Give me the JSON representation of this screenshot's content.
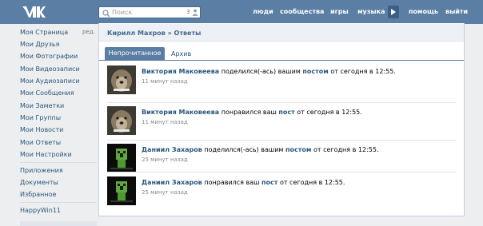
{
  "header": {
    "logo_text": "VK",
    "search": {
      "placeholder": "Поиск",
      "count": "3"
    },
    "nav": [
      "люди",
      "сообщества",
      "игры",
      "музыка",
      "помощь",
      "выйти"
    ]
  },
  "leftmenu": {
    "edit_label": "ред.",
    "items": [
      "Моя Страница",
      "Мои Друзья",
      "Мои Фотографии",
      "Мои Видеозаписи",
      "Мои Аудиозаписи",
      "Мои Сообщения",
      "Мои Заметки",
      "Мои Группы",
      "Мои Новости",
      "Мои Ответы",
      "Мои Настройки"
    ],
    "items2": [
      "Приложения",
      "Документы",
      "Избранное"
    ],
    "items3": [
      "HappyWin11"
    ]
  },
  "main": {
    "breadcrumb": "Кирилл Махров » Ответы",
    "tabs": {
      "active": "Непрочитанное",
      "other": "Архив"
    },
    "notifications": [
      {
        "name": "Виктория Маковеева",
        "pre": "поделился(-ась) вашим",
        "link": "постом",
        "post": "от сегодня в 12:55.",
        "time": "11 минут назад",
        "thumb": "dog"
      },
      {
        "name": "Виктория Маковеева",
        "pre": "понравился ваш",
        "link": "пост",
        "post": "от сегодня в 12:55.",
        "time": "11 минут назад",
        "thumb": "dog"
      },
      {
        "name": "Даниил Захаров",
        "pre": "поделился(-ась) вашим",
        "link": "постом",
        "post": "от сегодня в 12:55.",
        "time": "25 минут назад",
        "thumb": "creeper"
      },
      {
        "name": "Даниил Захаров",
        "pre": "понравился ваш",
        "link": "пост",
        "post": "от сегодня в 12:55.",
        "time": "25 минут назад",
        "thumb": "creeper"
      }
    ]
  },
  "colors": {
    "header_bg": "#5b7ea4",
    "link": "#2b587a",
    "tab_active_bg": "#597da3"
  }
}
